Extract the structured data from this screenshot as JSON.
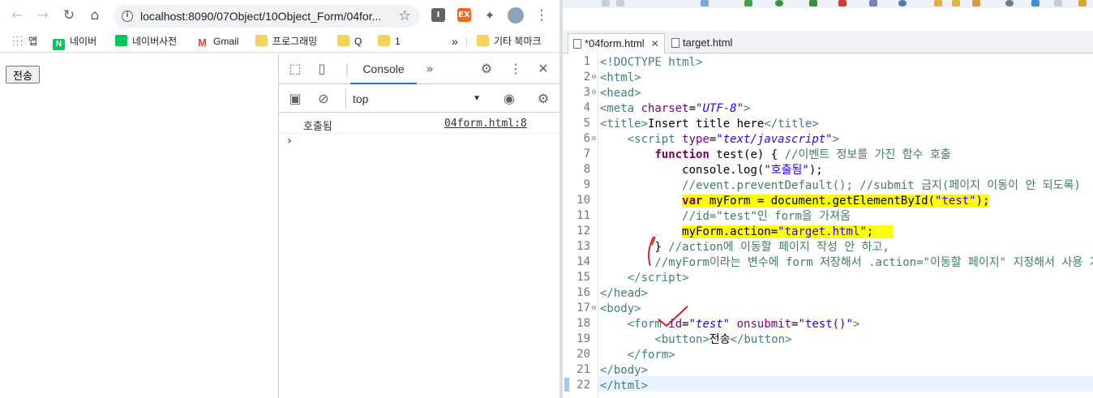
{
  "browser": {
    "url": "localhost:8090/07Object/10Object_Form/04for...",
    "bookmarks": [
      {
        "label": "앱",
        "icon": "apps-grid-icon"
      },
      {
        "label": "네이버",
        "icon": "naver-icon"
      },
      {
        "label": "네이버사전",
        "icon": "naver-dict-icon"
      },
      {
        "label": "Gmail",
        "icon": "gmail-icon"
      },
      {
        "label": "프로그래밍",
        "icon": "folder-icon"
      },
      {
        "label": "Q",
        "icon": "folder-icon"
      },
      {
        "label": "1",
        "icon": "folder-icon"
      },
      {
        "label": "기타 북마크",
        "icon": "folder-icon"
      }
    ],
    "overflow_label": "»",
    "page": {
      "submit_label": "전송"
    }
  },
  "devtools": {
    "console_tab": "Console",
    "more_tabs": "»",
    "context": "top",
    "log_message": "호출됨",
    "log_source": "04form.html:8",
    "prompt": "›"
  },
  "editor": {
    "tabs": [
      {
        "label": "*04form.html",
        "active": true
      },
      {
        "label": "target.html",
        "active": false
      }
    ],
    "line_numbers": [
      "1",
      "2",
      "3",
      "4",
      "5",
      "6",
      "7",
      "8",
      "9",
      "10",
      "11",
      "12",
      "13",
      "14",
      "15",
      "16",
      "17",
      "18",
      "19",
      "20",
      "21",
      "22"
    ]
  },
  "colors": {
    "highlight": "#ffff00",
    "tag": "#3f7f7f",
    "attribute": "#7f007f",
    "keyword": "#7f0055",
    "comment": "#3f7f5f",
    "string": "#2a00ff",
    "accent": "#1a73e8",
    "annotation": "#e00000"
  }
}
